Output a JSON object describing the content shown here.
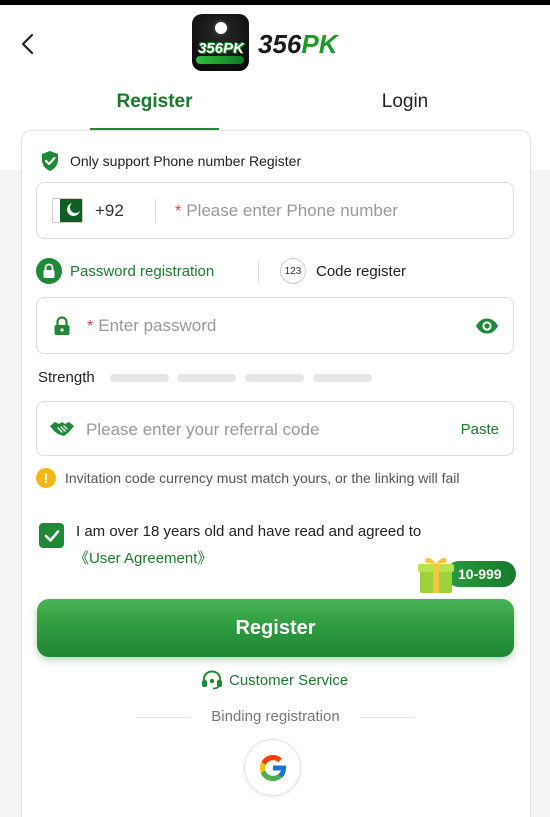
{
  "brand": {
    "logo_mark": "356PK",
    "name_part1": "356",
    "name_part2": "PK"
  },
  "tabs": [
    {
      "label": "Register",
      "active": true
    },
    {
      "label": "Login",
      "active": false
    }
  ],
  "notice": {
    "text": "Only support Phone number Register",
    "icon": "shield-check-icon"
  },
  "phone": {
    "country_flag": "pakistan-flag-icon",
    "country_code": "+92",
    "required_mark": "*",
    "placeholder": "Please enter Phone number"
  },
  "modes": [
    {
      "label": "Password registration",
      "icon": "lock-icon",
      "active": true
    },
    {
      "label": "Code register",
      "icon": "123-icon",
      "icon_text": "123",
      "active": false
    }
  ],
  "password": {
    "required_mark": "*",
    "placeholder": "Enter password"
  },
  "strength": {
    "label": "Strength",
    "level": 0
  },
  "referral": {
    "placeholder": "Please enter your referral code",
    "paste_label": "Paste"
  },
  "warning": {
    "icon_text": "!",
    "text": "Invitation code currency must match yours, or the linking will fail"
  },
  "agreement": {
    "checked": true,
    "text": "I am over 18 years old and have read and agreed to",
    "link": "《User Agreement》"
  },
  "bonus_badge": {
    "text": "10-999"
  },
  "register_button": "Register",
  "customer_service": "Customer Service",
  "binding_label": "Binding registration",
  "colors": {
    "primary_green": "#1f8a35",
    "text_green": "#1f7a30",
    "required_red": "#d94040",
    "warning_yellow": "#f3b818"
  }
}
